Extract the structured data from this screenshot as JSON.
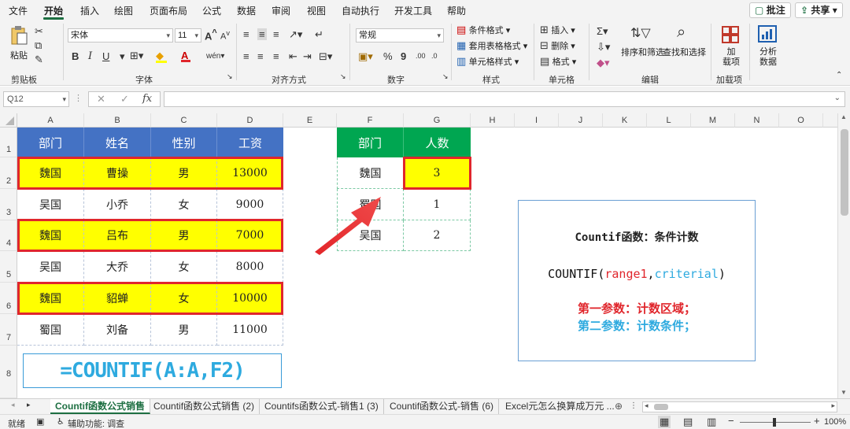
{
  "menu": {
    "tabs": [
      "文件",
      "开始",
      "插入",
      "绘图",
      "页面布局",
      "公式",
      "数据",
      "审阅",
      "视图",
      "自动执行",
      "开发工具",
      "帮助"
    ],
    "active": "开始",
    "comment_label": "批注",
    "share_label": "共享"
  },
  "ribbon": {
    "clipboard": {
      "paste": "粘贴",
      "label": "剪贴板"
    },
    "font": {
      "name": "宋体",
      "size": "11",
      "label": "字体",
      "bold": "B",
      "italic": "I",
      "underline": "U",
      "grow": "A",
      "shrink": "A"
    },
    "align": {
      "label": "对齐方式"
    },
    "number": {
      "format": "常规",
      "label": "数字",
      "percent": "%",
      "comma": "9"
    },
    "styles": {
      "cond": "条件格式",
      "table": "套用表格格式",
      "cell": "单元格样式",
      "label": "样式"
    },
    "cells": {
      "insert": "插入",
      "delete": "删除",
      "format": "格式",
      "label": "单元格"
    },
    "edit": {
      "sort": "排序和筛选",
      "find": "查找和选择",
      "label": "编辑"
    },
    "addins": {
      "btn": "加\n载项",
      "label": "加载项"
    },
    "analysis": {
      "btn": "分析\n数据"
    }
  },
  "formula_bar": {
    "name_box": "Q12",
    "fx": "fx",
    "formula": ""
  },
  "columns": [
    "A",
    "B",
    "C",
    "D",
    "E",
    "F",
    "G",
    "H",
    "I",
    "J",
    "K",
    "L",
    "M",
    "N",
    "O"
  ],
  "rows": [
    "1",
    "2",
    "3",
    "4",
    "5",
    "6",
    "7",
    "8"
  ],
  "table1": {
    "headers": [
      "部门",
      "姓名",
      "性别",
      "工资"
    ],
    "rows": [
      [
        "魏国",
        "曹操",
        "男",
        "13000"
      ],
      [
        "吴国",
        "小乔",
        "女",
        "9000"
      ],
      [
        "魏国",
        "吕布",
        "男",
        "7000"
      ],
      [
        "吴国",
        "大乔",
        "女",
        "8000"
      ],
      [
        "魏国",
        "貂蝉",
        "女",
        "10000"
      ],
      [
        "蜀国",
        "刘备",
        "男",
        "11000"
      ]
    ]
  },
  "table2": {
    "headers": [
      "部门",
      "人数"
    ],
    "rows": [
      [
        "魏国",
        "3"
      ],
      [
        "蜀国",
        "1"
      ],
      [
        "吴国",
        "2"
      ]
    ]
  },
  "formula_display": "=COUNTIF(A:A,F2)",
  "info": {
    "title": "Countif函数：条件计数",
    "syntax_fn": "COUNTIF(",
    "syntax_a1": "range1",
    "syntax_comma": ",",
    "syntax_a2": "criterial",
    "syntax_end": ")",
    "p1": "第一参数：计数区域；",
    "p2": "第二参数：计数条件；",
    "colors": {
      "title": "#111111",
      "arg1": "#e0262c",
      "arg2": "#2eaadf"
    }
  },
  "sheets": [
    "Countif函数公式销售",
    "Countif函数公式销售 (2)",
    "Countifs函数公式-销售1 (3)",
    "Countif函数公式-销售 (6)",
    "Excel元怎么换算成万元 ..."
  ],
  "status": {
    "ready": "就绪",
    "accessibility": "辅助功能: 调查",
    "zoom": "100%"
  }
}
